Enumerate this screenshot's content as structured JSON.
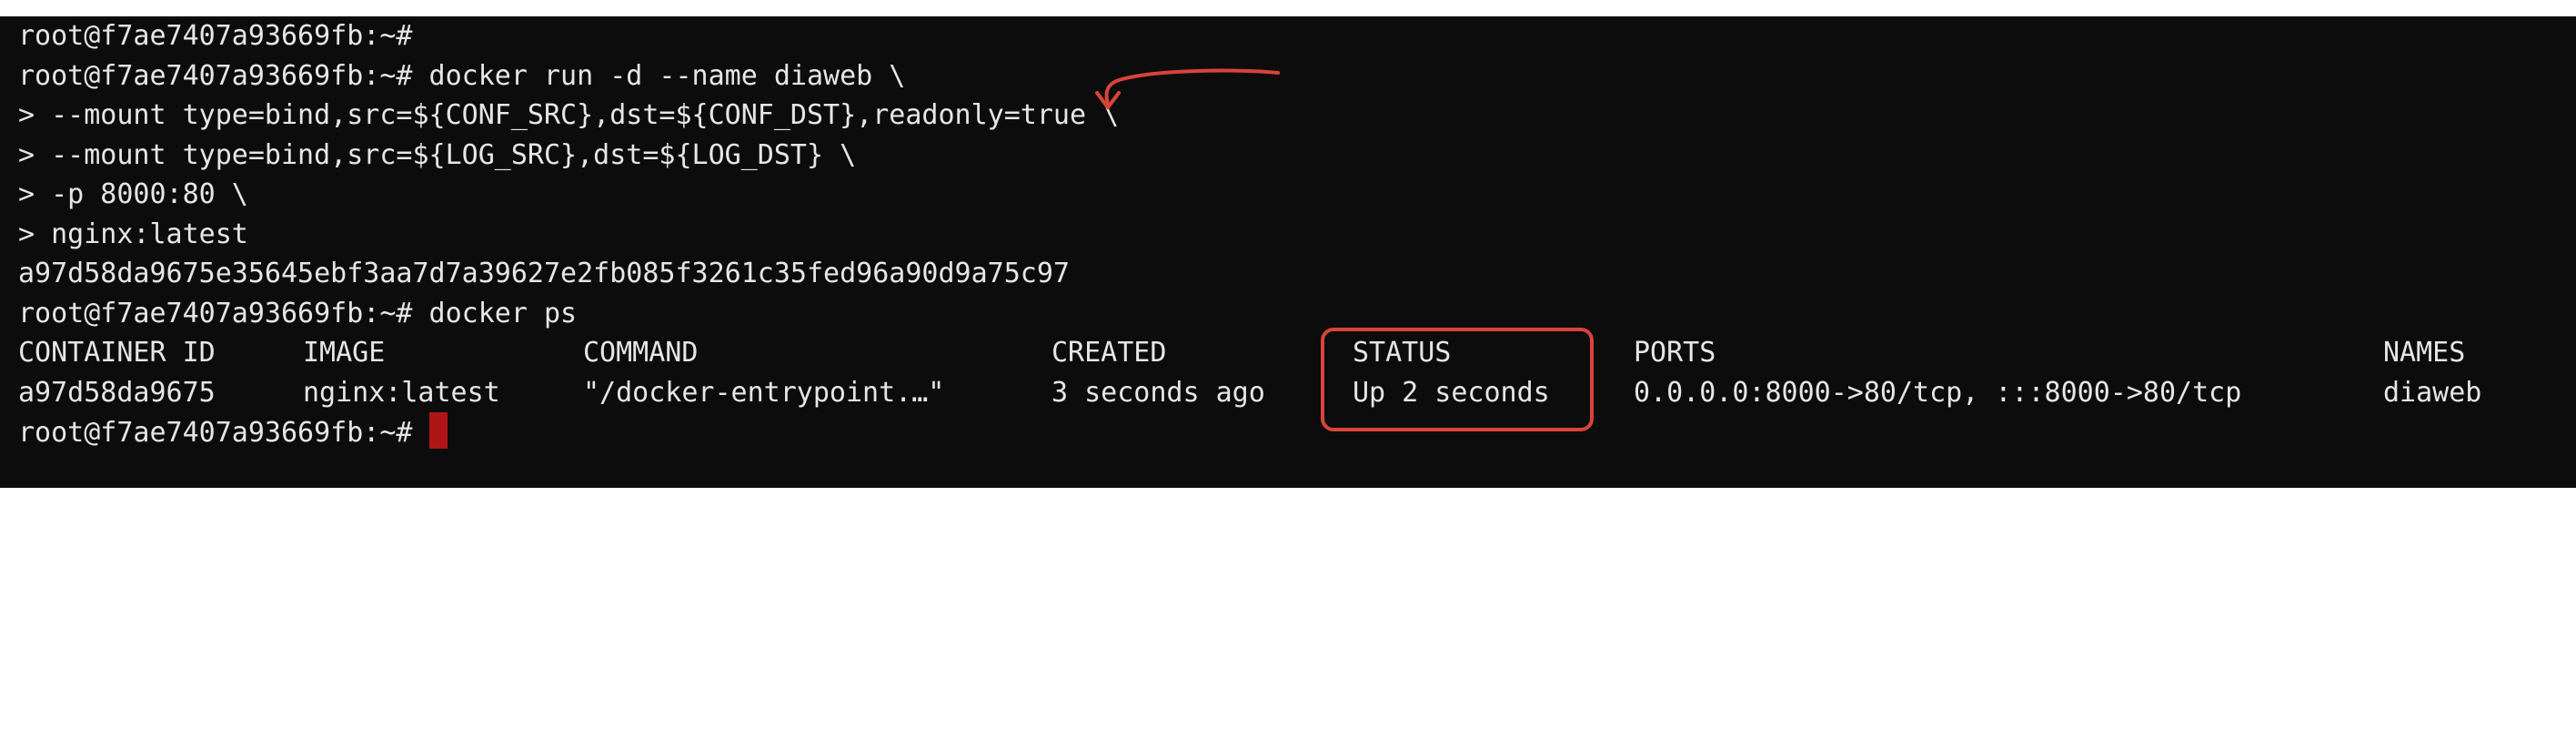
{
  "colors": {
    "terminal_bg": "#0c0c0c",
    "terminal_fg": "#e6e6e6",
    "cursor": "#b01515",
    "annotation": "#d9433a"
  },
  "terminal": {
    "lines": [
      "root@f7ae7407a93669fb:~#",
      "root@f7ae7407a93669fb:~# docker run -d --name diaweb \\",
      "> --mount type=bind,src=${CONF_SRC},dst=${CONF_DST},readonly=true \\",
      "> --mount type=bind,src=${LOG_SRC},dst=${LOG_DST} \\",
      "> -p 8000:80 \\",
      "> nginx:latest",
      "a97d58da9675e35645ebf3aa7d7a39627e2fb085f3261c35fed96a90d9a75c97",
      "root@f7ae7407a93669fb:~# docker ps"
    ],
    "ps_table": {
      "headers": [
        "CONTAINER ID",
        "IMAGE",
        "COMMAND",
        "CREATED",
        "STATUS",
        "PORTS",
        "NAMES"
      ],
      "row": [
        "a97d58da9675",
        "nginx:latest",
        "\"/docker-entrypoint.…\"",
        "3 seconds ago",
        "Up 2 seconds",
        "0.0.0.0:8000->80/tcp, :::8000->80/tcp",
        "diaweb"
      ]
    },
    "final_prompt": "root@f7ae7407a93669fb:~# "
  },
  "annotations": {
    "status_box": "highlight-box",
    "arrow": "curved-arrow-icon"
  }
}
